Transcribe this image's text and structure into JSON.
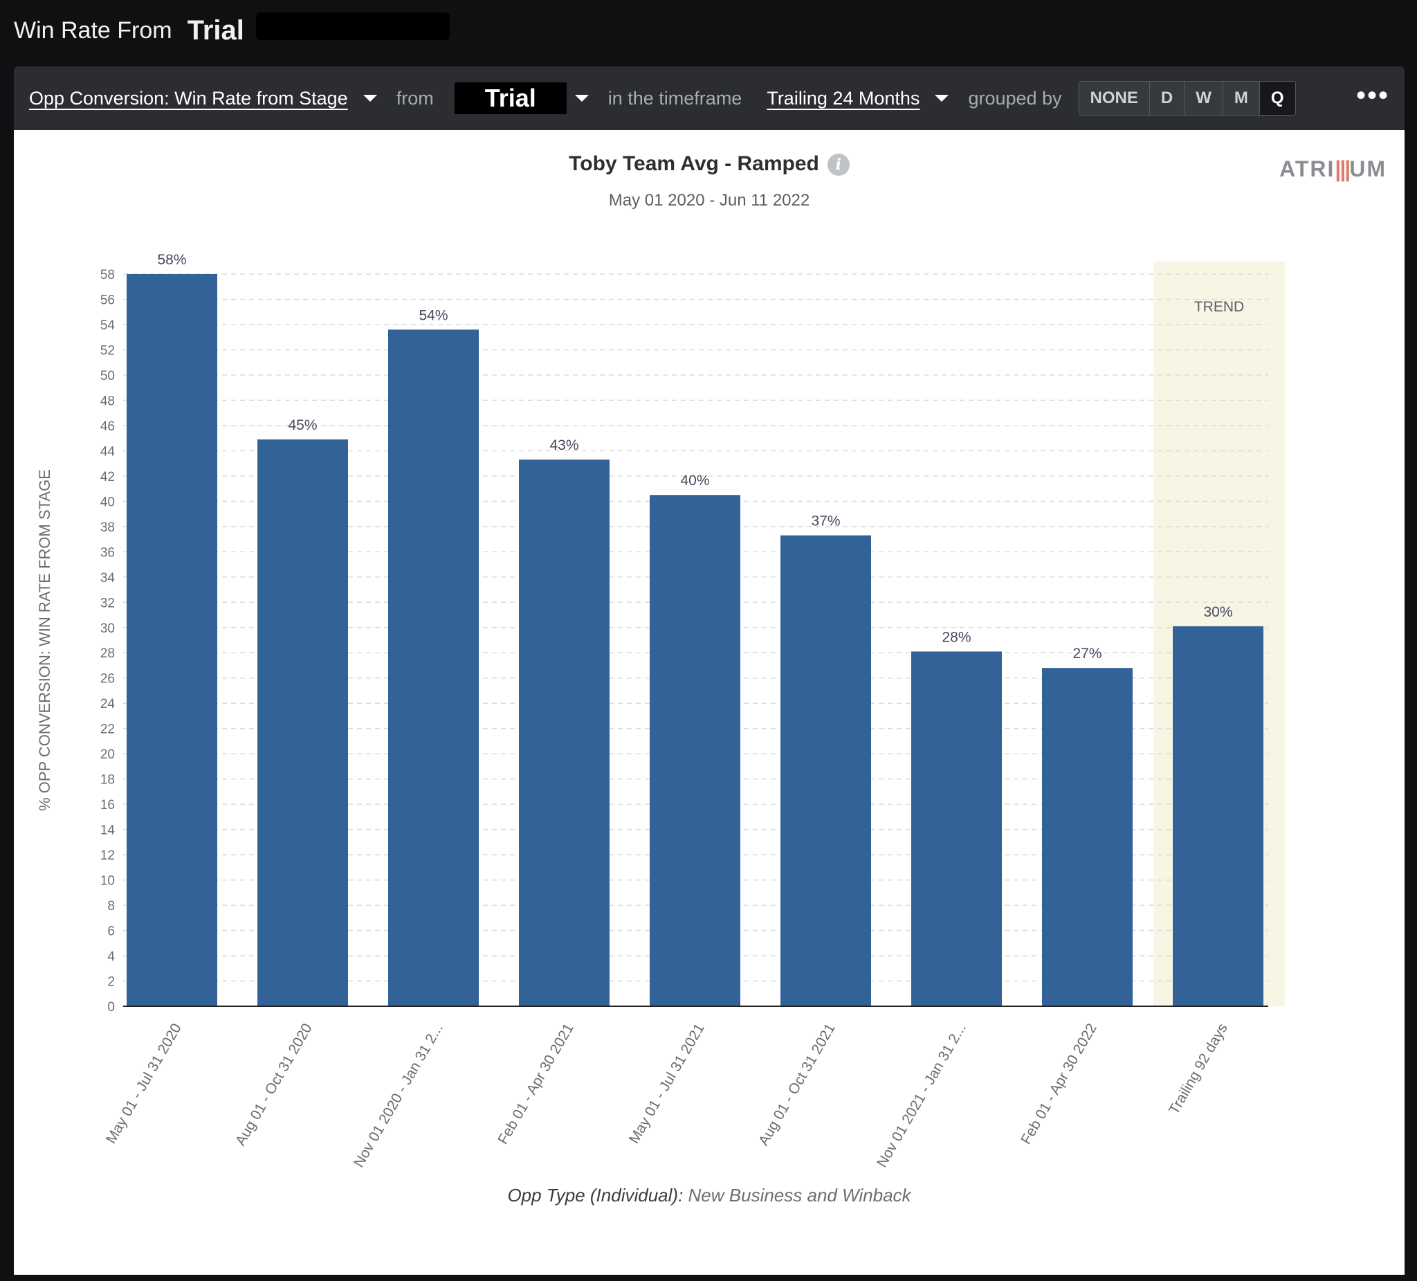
{
  "page": {
    "title_prefix": "Win Rate From",
    "title_stage": "Trial"
  },
  "toolbar": {
    "metric_label": "Opp Conversion: Win Rate from Stage",
    "from_label": "from",
    "stage_value": "Trial",
    "timeframe_label": "in the timeframe",
    "timeframe_value": "Trailing 24 Months",
    "grouped_label": "grouped by",
    "group_options": [
      "NONE",
      "D",
      "W",
      "M",
      "Q"
    ],
    "group_selected": "Q",
    "more_icon": "ellipsis-icon"
  },
  "logo": {
    "text_a": "ATRI",
    "text_bars": "|||",
    "text_b": "UM"
  },
  "chart_data": {
    "type": "bar",
    "title": "Toby Team Avg - Ramped",
    "subtitle": "May 01 2020 - Jun 11 2022",
    "ylabel": "% OPP CONVERSION: WIN RATE FROM STAGE",
    "ylim": [
      0,
      58
    ],
    "yticks": [
      0,
      2,
      4,
      6,
      8,
      10,
      12,
      14,
      16,
      18,
      20,
      22,
      24,
      26,
      28,
      30,
      32,
      34,
      36,
      38,
      40,
      42,
      44,
      46,
      48,
      50,
      52,
      54,
      56,
      58
    ],
    "grid": true,
    "categories": [
      "May 01 - Jul 31 2020",
      "Aug 01 - Oct 31 2020",
      "Nov 01 2020 - Jan 31 2...",
      "Feb 01 - Apr 30 2021",
      "May 01 - Jul 31 2021",
      "Aug 01 - Oct 31 2021",
      "Nov 01 2021 - Jan 31 2...",
      "Feb 01 - Apr 30 2022",
      "Trailing 92 days"
    ],
    "values": [
      58,
      44.9,
      53.6,
      43.3,
      40.5,
      37.3,
      28.1,
      26.8,
      30.1
    ],
    "data_labels": [
      "58%",
      "45%",
      "54%",
      "43%",
      "40%",
      "37%",
      "28%",
      "27%",
      "30%"
    ],
    "trend_label": "TREND",
    "trend_index": 8,
    "bar_color": "#336298",
    "trend_bg_color": "#f7f5e4"
  },
  "footer": {
    "filter_label": "Opp Type (Individual):",
    "filter_value": "New Business and Winback"
  }
}
